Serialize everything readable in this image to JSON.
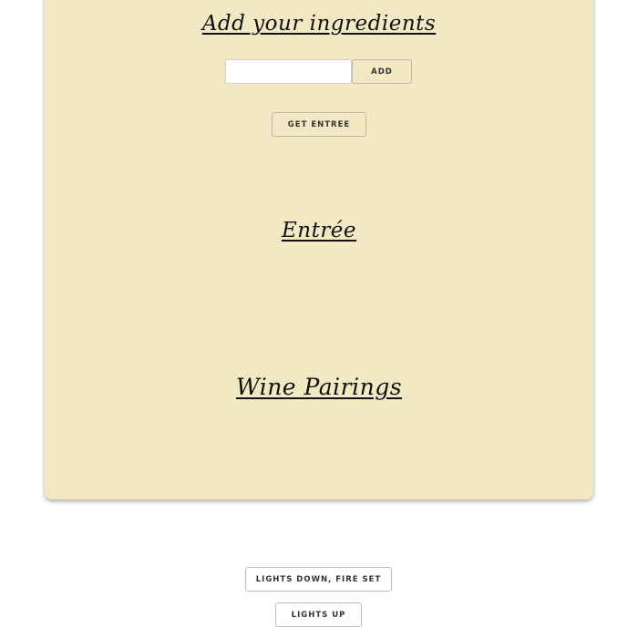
{
  "ingredients_section": {
    "heading": "Add your ingredients",
    "input_value": "",
    "input_placeholder": "",
    "add_button_label": "ADD",
    "get_entree_button_label": "GET ENTREE"
  },
  "entree_section": {
    "heading": "Entrée"
  },
  "wine_section": {
    "heading": "Wine Pairings"
  },
  "controls": {
    "lights_down_label": "LIGHTS DOWN, FIRE SET",
    "lights_up_label": "LIGHTS UP"
  },
  "colors": {
    "card_background": "#f3e8c4",
    "heading_text": "#111111",
    "page_background": "#ffffff"
  }
}
